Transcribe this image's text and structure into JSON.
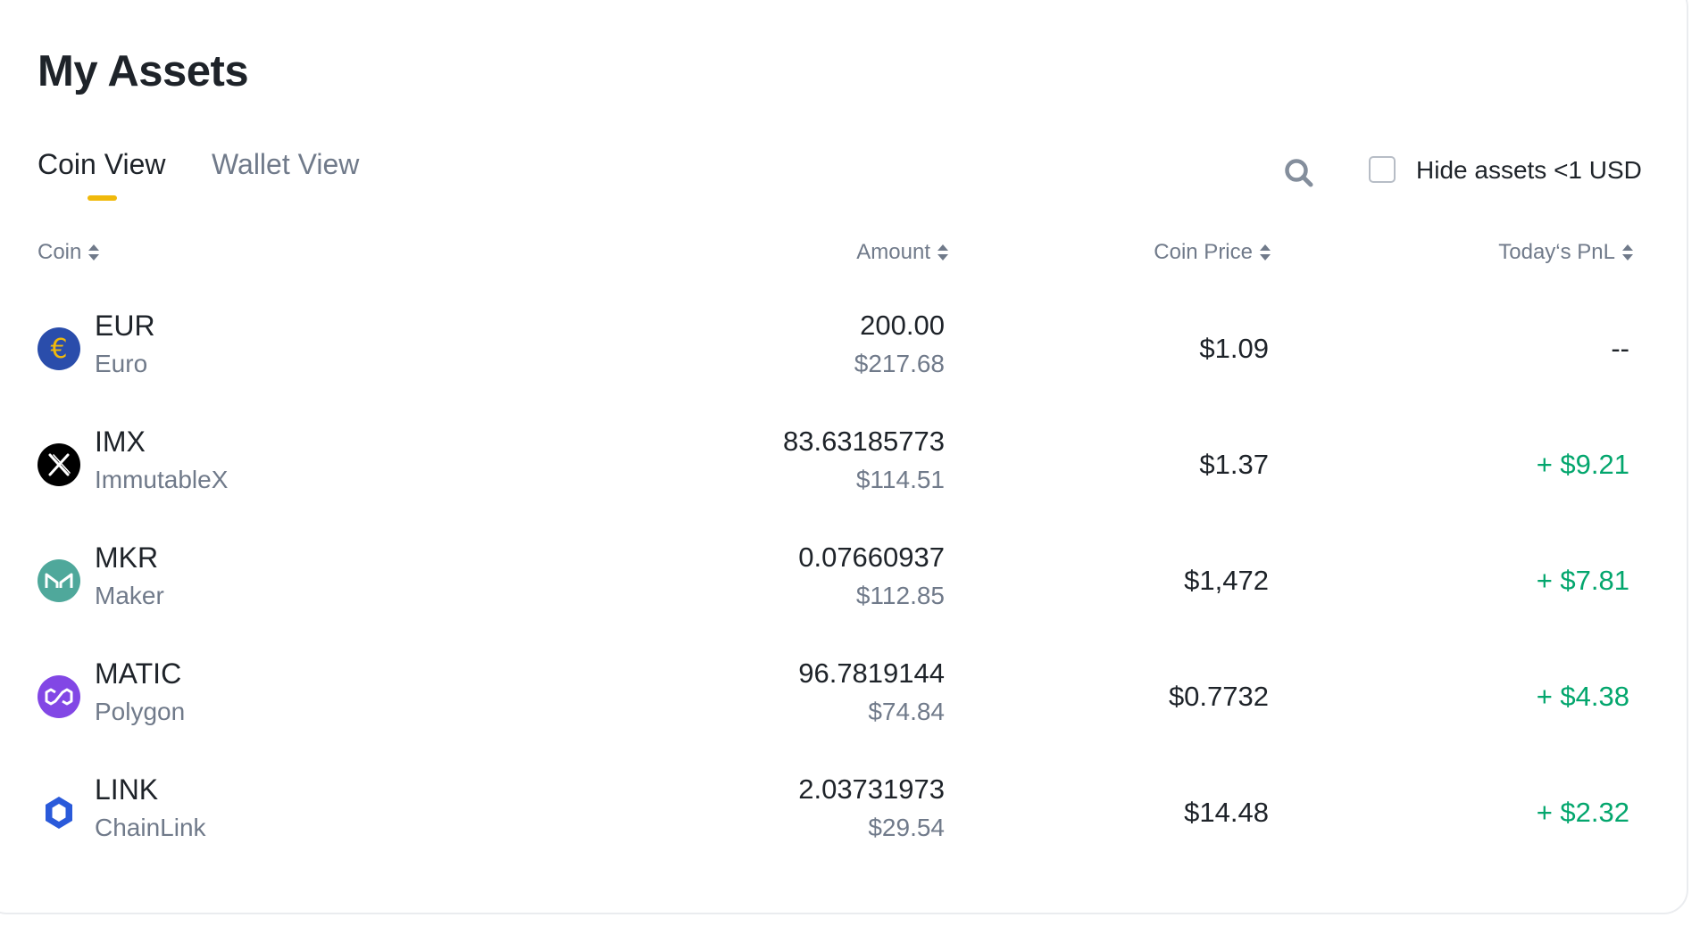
{
  "header": {
    "title": "My Assets"
  },
  "tabs": [
    {
      "label": "Coin View",
      "active": true
    },
    {
      "label": "Wallet View",
      "active": false
    }
  ],
  "toolbar": {
    "search_icon": "search-icon",
    "hide_small_label": "Hide assets <1 USD",
    "hide_small_checked": false
  },
  "columns": {
    "coin": "Coin",
    "amount": "Amount",
    "price": "Coin Price",
    "pnl": "Today‘s PnL"
  },
  "assets": [
    {
      "symbol": "EUR",
      "name": "Euro",
      "amount": "200.00",
      "amount_usd": "$217.68",
      "price": "$1.09",
      "pnl": "--",
      "icon": "euro-coin-icon",
      "color": "#2a4dab"
    },
    {
      "symbol": "IMX",
      "name": "ImmutableX",
      "amount": "83.63185773",
      "amount_usd": "$114.51",
      "price": "$1.37",
      "pnl": "+ $9.21",
      "icon": "immutablex-coin-icon",
      "color": "#000000"
    },
    {
      "symbol": "MKR",
      "name": "Maker",
      "amount": "0.07660937",
      "amount_usd": "$112.85",
      "price": "$1,472",
      "pnl": "+ $7.81",
      "icon": "maker-coin-icon",
      "color": "#4fa89b"
    },
    {
      "symbol": "MATIC",
      "name": "Polygon",
      "amount": "96.7819144",
      "amount_usd": "$74.84",
      "price": "$0.7732",
      "pnl": "+ $4.38",
      "icon": "polygon-coin-icon",
      "color": "#8247e5"
    },
    {
      "symbol": "LINK",
      "name": "ChainLink",
      "amount": "2.03731973",
      "amount_usd": "$29.54",
      "price": "$14.48",
      "pnl": "+ $2.32",
      "icon": "chainlink-coin-icon",
      "color": "#2a5ada"
    }
  ],
  "colors": {
    "accent": "#f0b90b",
    "positive": "#03a66d",
    "text_primary": "#1e2329",
    "text_secondary": "#707a8a",
    "border": "#eaecef"
  }
}
